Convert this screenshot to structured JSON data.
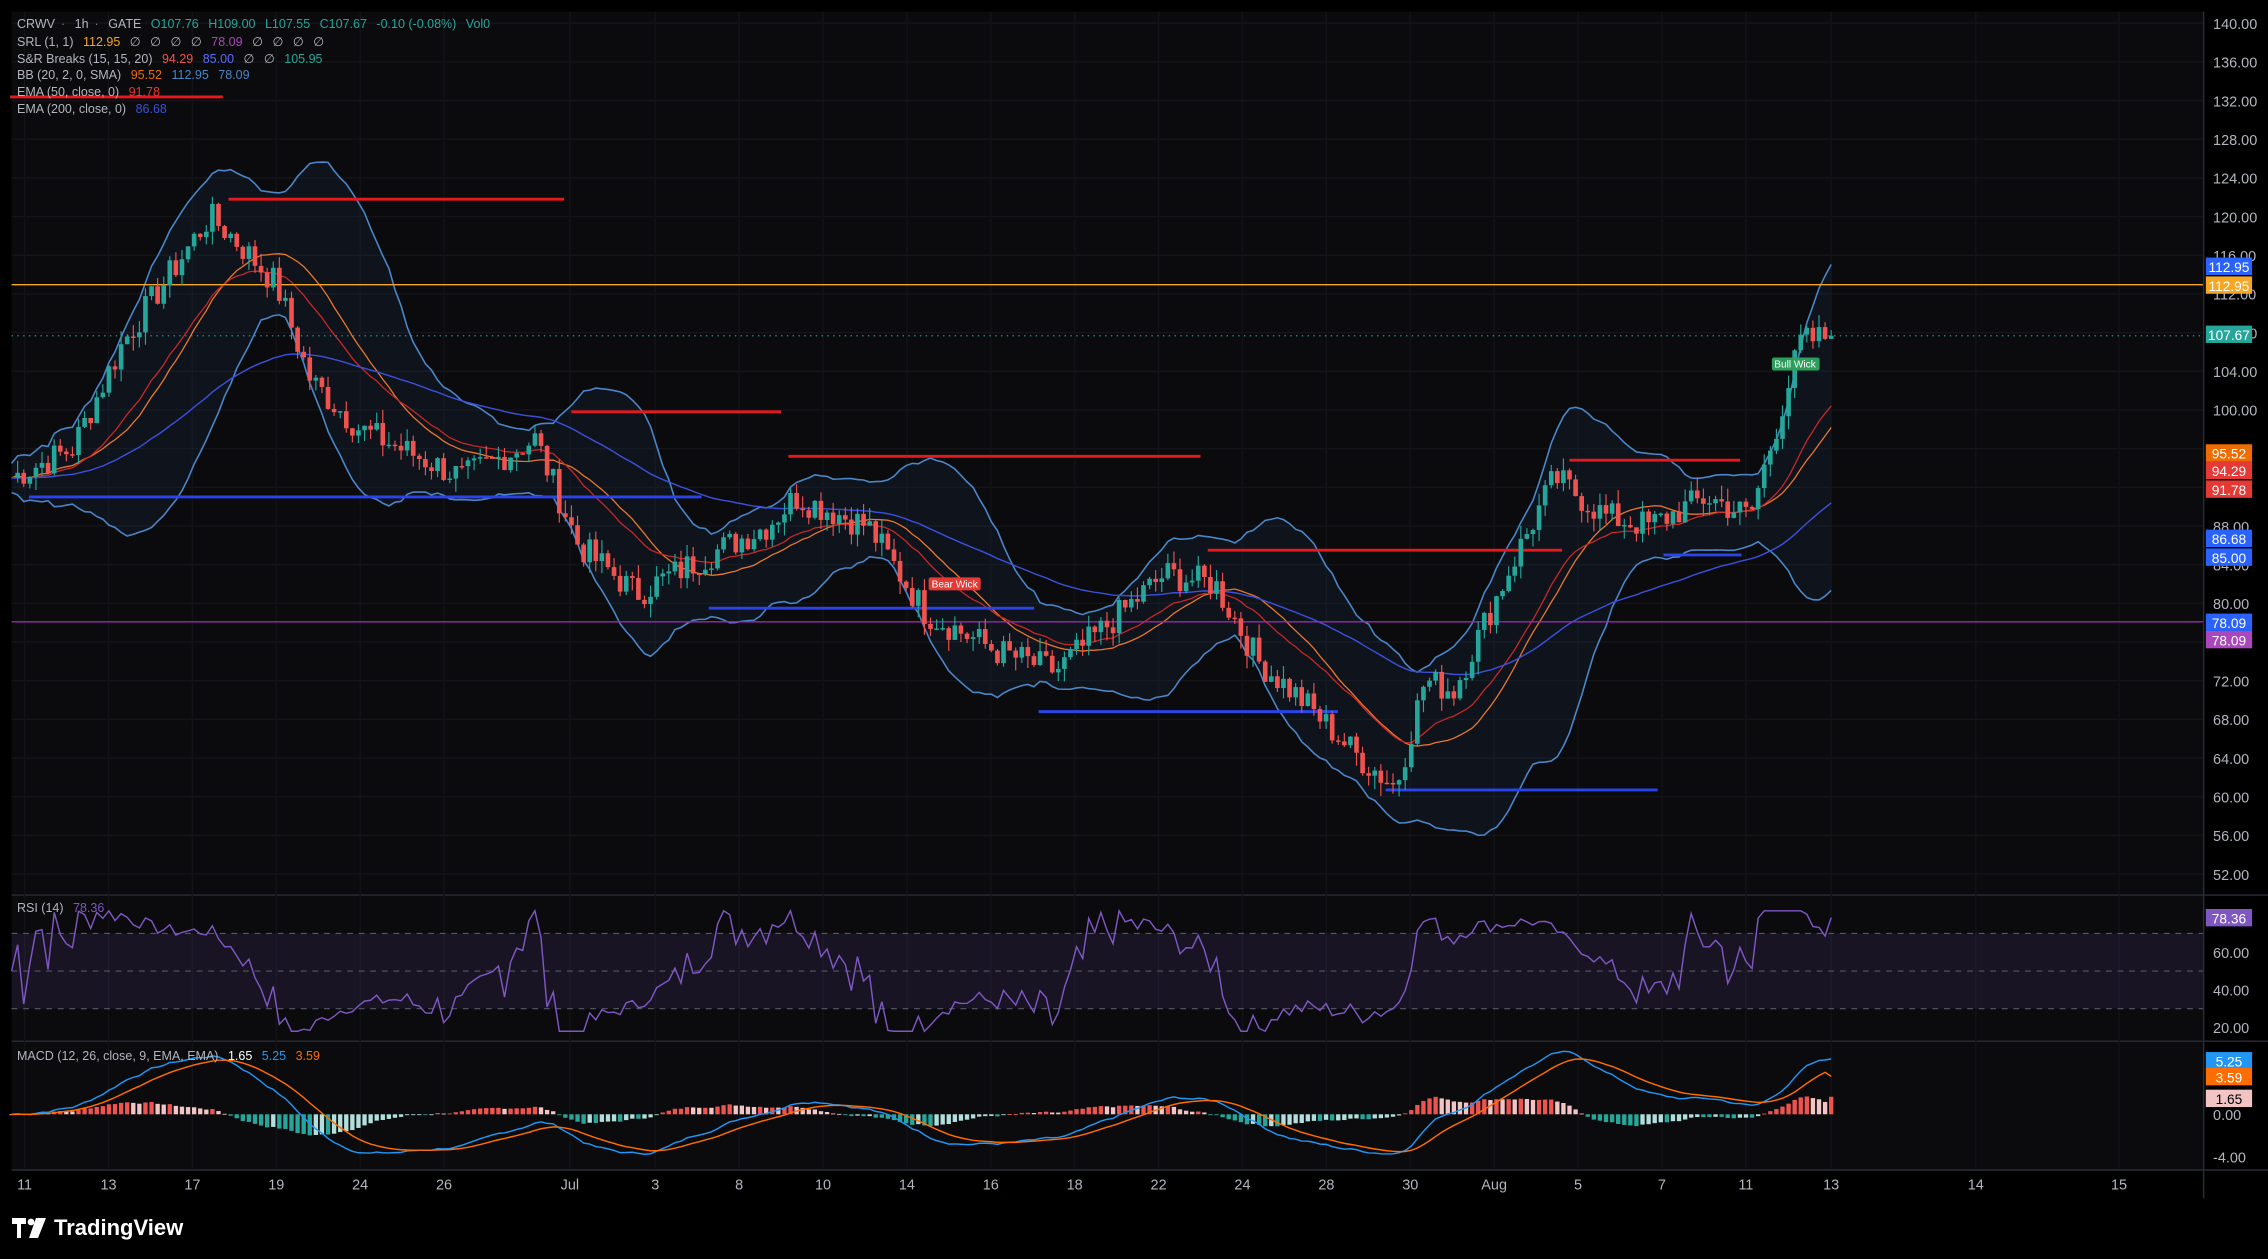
{
  "header": {
    "symbol": "CRWV",
    "interval": "1h",
    "exchange": "GATE",
    "open": "O107.76",
    "high": "H109.00",
    "low": "L107.55",
    "close": "C107.67",
    "change": "-0.10 (-0.08%)",
    "volume": "Vol0"
  },
  "indicators": {
    "srl": {
      "label": "SRL (1, 1)",
      "values": [
        "112.95",
        "∅",
        "∅",
        "∅",
        "∅",
        "78.09",
        "∅",
        "∅",
        "∅",
        "∅"
      ]
    },
    "snr": {
      "label": "S&R Breaks (15, 15, 20)",
      "values": [
        "94.29",
        "85.00",
        "∅",
        "∅",
        "105.95"
      ]
    },
    "bb": {
      "label": "BB (20, 2, 0, SMA)",
      "values": [
        "95.52",
        "112.95",
        "78.09"
      ]
    },
    "ema50": {
      "label": "EMA (50, close, 0)",
      "value": "91.78"
    },
    "ema200": {
      "label": "EMA (200, close, 0)",
      "value": "86.68"
    },
    "rsi": {
      "label": "RSI (14)",
      "value": "78.36"
    },
    "macd": {
      "label": "MACD (12, 26, close, 9, EMA, EMA)",
      "values": [
        "1.65",
        "5.25",
        "3.59"
      ]
    }
  },
  "colors": {
    "background": "#000000",
    "up": "#26a69a",
    "down": "#ef5350",
    "bb": "#4a86c8",
    "ema50": "#e8772c",
    "ema200": "#3b4fd8",
    "resistance": "#e41a1c",
    "support": "#2a44e8",
    "srl_line": "#f5a623",
    "srl_low": "#9c27b0",
    "rsi": "#7e57c2",
    "macd": "#2196f3",
    "signal": "#ff6d00"
  },
  "price_axis": [
    "140.00",
    "136.00",
    "132.00",
    "128.00",
    "124.00",
    "120.00",
    "116.00",
    "112.00",
    "108.00",
    "104.00",
    "100.00",
    "96.00",
    "92.00",
    "88.00",
    "84.00",
    "80.00",
    "76.00",
    "72.00",
    "68.00",
    "64.00",
    "60.00",
    "56.00",
    "52.00"
  ],
  "price_badges": [
    {
      "text": "112.95",
      "color": "#2962ff"
    },
    {
      "text": "112.95",
      "color": "#f5a623"
    },
    {
      "text": "107.67",
      "color": "#26a69a"
    },
    {
      "text": "95.52",
      "color": "#ef6c00"
    },
    {
      "text": "94.29",
      "color": "#e53935"
    },
    {
      "text": "91.78",
      "color": "#e53935"
    },
    {
      "text": "86.68",
      "color": "#2962ff"
    },
    {
      "text": "85.00",
      "color": "#2962ff"
    },
    {
      "text": "78.09",
      "color": "#2962ff"
    },
    {
      "text": "78.09",
      "color": "#ab47bc"
    }
  ],
  "rsi_axis": [
    "80.00",
    "60.00",
    "40.00",
    "20.00"
  ],
  "macd_axis": [
    "0.00",
    "-4.00"
  ],
  "time_axis": [
    "11",
    "13",
    "17",
    "19",
    "24",
    "26",
    "Jul",
    "3",
    "8",
    "10",
    "14",
    "16",
    "18",
    "22",
    "24",
    "28",
    "30",
    "Aug",
    "5",
    "7",
    "11",
    "13",
    "14",
    "15"
  ],
  "labels": {
    "bear_wick": "Bear Wick",
    "bull_wick": "Bull Wick"
  },
  "branding": "TradingView",
  "chart_data": {
    "type": "candlestick",
    "title": "CRWV · 1h · GATE",
    "ylim": [
      50,
      142
    ],
    "price_keypoints": [
      {
        "t": "Jun 10",
        "close": 93
      },
      {
        "t": "Jun 12",
        "close": 96
      },
      {
        "t": "Jun 14",
        "close": 107
      },
      {
        "t": "Jun 17",
        "close": 120
      },
      {
        "t": "Jun 18",
        "close": 118
      },
      {
        "t": "Jun 19",
        "close": 113
      },
      {
        "t": "Jun 21",
        "close": 103
      },
      {
        "t": "Jun 24",
        "close": 98
      },
      {
        "t": "Jun 27",
        "close": 93
      },
      {
        "t": "Jun 28",
        "close": 97
      },
      {
        "t": "Jul 1",
        "close": 86
      },
      {
        "t": "Jul 3",
        "close": 81
      },
      {
        "t": "Jul 5",
        "close": 85
      },
      {
        "t": "Jul 8",
        "close": 88
      },
      {
        "t": "Jul 9",
        "close": 91
      },
      {
        "t": "Jul 11",
        "close": 88
      },
      {
        "t": "Jul 14",
        "close": 79
      },
      {
        "t": "Jul 16",
        "close": 75
      },
      {
        "t": "Jul 18",
        "close": 73
      },
      {
        "t": "Jul 19",
        "close": 77
      },
      {
        "t": "Jul 21",
        "close": 83
      },
      {
        "t": "Jul 23",
        "close": 82
      },
      {
        "t": "Jul 25",
        "close": 74
      },
      {
        "t": "Jul 27",
        "close": 70
      },
      {
        "t": "Jul 29",
        "close": 64
      },
      {
        "t": "Jul 30",
        "close": 61
      },
      {
        "t": "Jul 31",
        "close": 72
      },
      {
        "t": "Aug 2",
        "close": 71
      },
      {
        "t": "Aug 3",
        "close": 84
      },
      {
        "t": "Aug 4",
        "close": 93
      },
      {
        "t": "Aug 6",
        "close": 89
      },
      {
        "t": "Aug 7",
        "close": 88
      },
      {
        "t": "Aug 9",
        "close": 91
      },
      {
        "t": "Aug 11",
        "close": 89
      },
      {
        "t": "Aug 12",
        "close": 107
      },
      {
        "t": "Aug 13",
        "close": 107.67
      }
    ],
    "resistance_levels": [
      121.8,
      99.8,
      95.2,
      85.5,
      94.8
    ],
    "support_levels": [
      91.0,
      79.5,
      68.8,
      60.7,
      85.0
    ],
    "horizontal_lines": [
      112.95,
      78.09,
      107.67
    ],
    "rsi_levels": [
      70,
      50,
      30
    ],
    "rsi_last": 78.36,
    "macd_last": 1.65,
    "macd_line_last": 5.25,
    "signal_last": 3.59
  }
}
